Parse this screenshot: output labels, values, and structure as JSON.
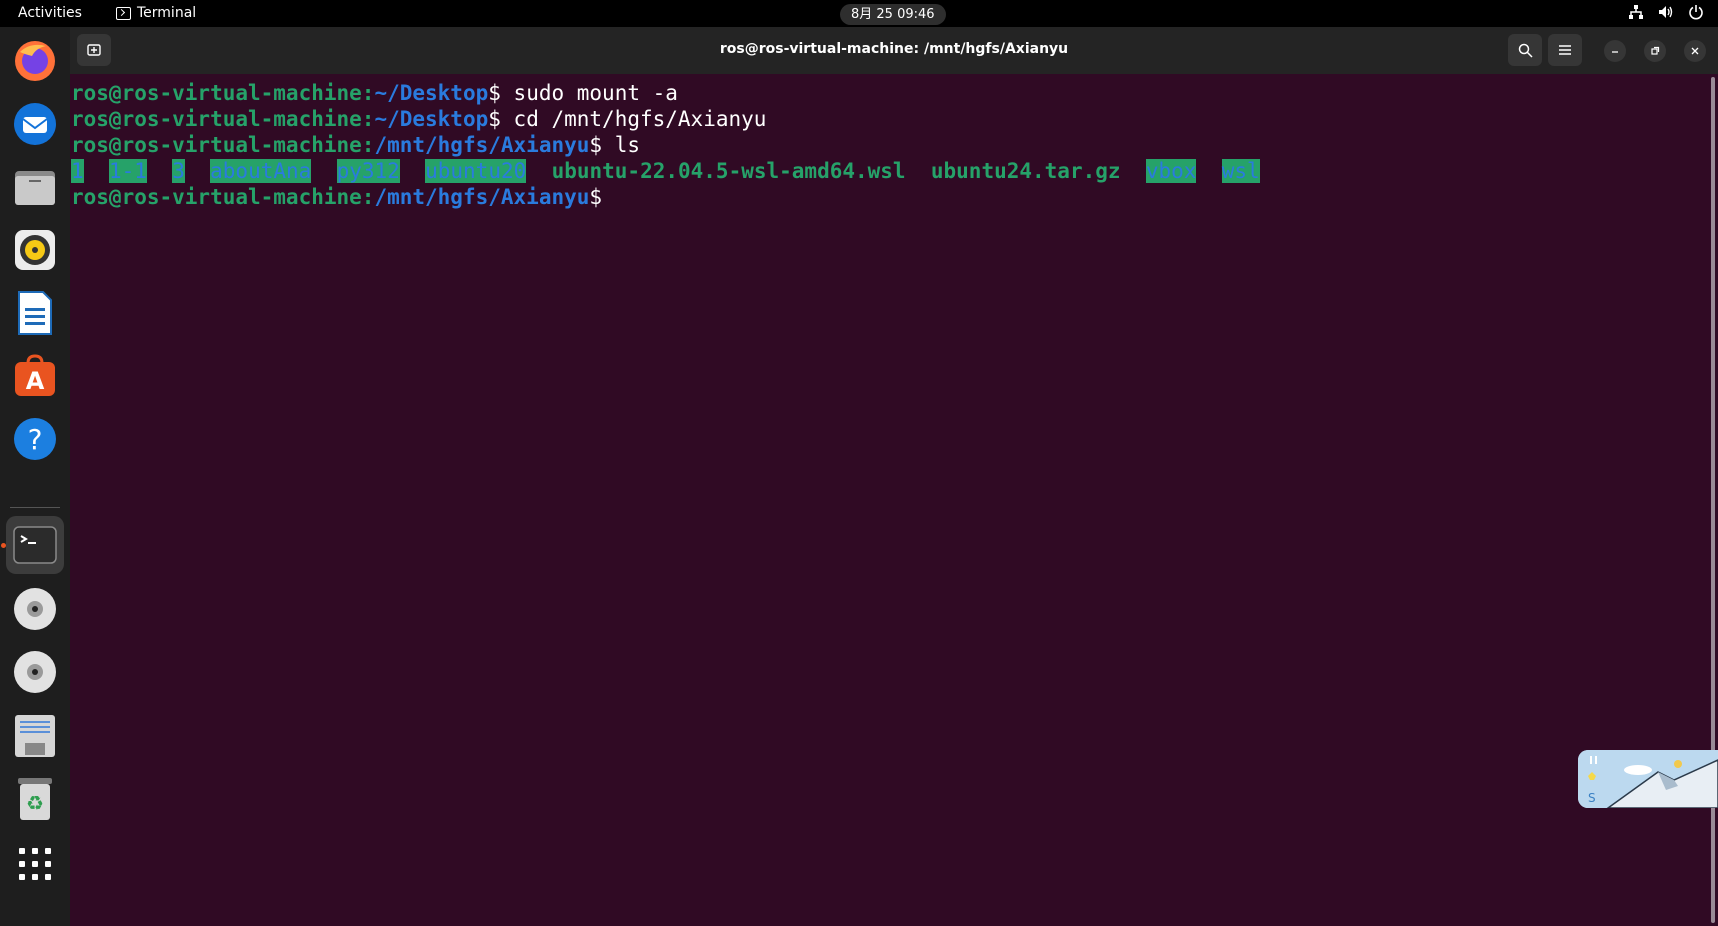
{
  "topbar": {
    "activities": "Activities",
    "app_name": "Terminal",
    "clock": "8月 25  09:46",
    "tray_icons": [
      "network-icon",
      "volume-icon",
      "power-icon"
    ]
  },
  "dock": {
    "items": [
      "Firefox",
      "Thunderbird",
      "Files",
      "Rhythmbox",
      "LibreOffice Writer",
      "Ubuntu Software",
      "Help",
      "Terminal",
      "DVD drive",
      "DVD drive",
      "Disk image",
      "Trash",
      "Show Applications"
    ]
  },
  "window": {
    "title": "ros@ros-virtual-machine: /mnt/hgfs/Axianyu"
  },
  "terminal": {
    "lines": [
      {
        "user": "ros@ros-virtual-machine",
        "sep": ":",
        "path": "~/Desktop",
        "prompt": "$ ",
        "cmd": "sudo mount -a"
      },
      {
        "user": "ros@ros-virtual-machine",
        "sep": ":",
        "path": "~/Desktop",
        "prompt": "$ ",
        "cmd": "cd /mnt/hgfs/Axianyu"
      },
      {
        "user": "ros@ros-virtual-machine",
        "sep": ":",
        "path": "/mnt/hgfs/Axianyu",
        "prompt": "$ ",
        "cmd": "ls"
      },
      {
        "user": "ros@ros-virtual-machine",
        "sep": ":",
        "path": "/mnt/hgfs/Axianyu",
        "prompt": "$",
        "cmd": ""
      }
    ],
    "ls_output": {
      "d0": "1",
      "d1": "1-1",
      "d2": "3",
      "d3": "aboutAna",
      "d4": "py312",
      "d5": "ubuntu20",
      "f0": "ubuntu-22.04.5-wsl-amd64.wsl",
      "f1": "ubuntu24.tar.gz",
      "d6": "vbox",
      "d7": "wsl"
    }
  },
  "colors": {
    "terminal_bg": "#300a24",
    "prompt_user": "#26a269",
    "prompt_path": "#2a7bde",
    "dir_highlight_bg": "#26a269"
  }
}
